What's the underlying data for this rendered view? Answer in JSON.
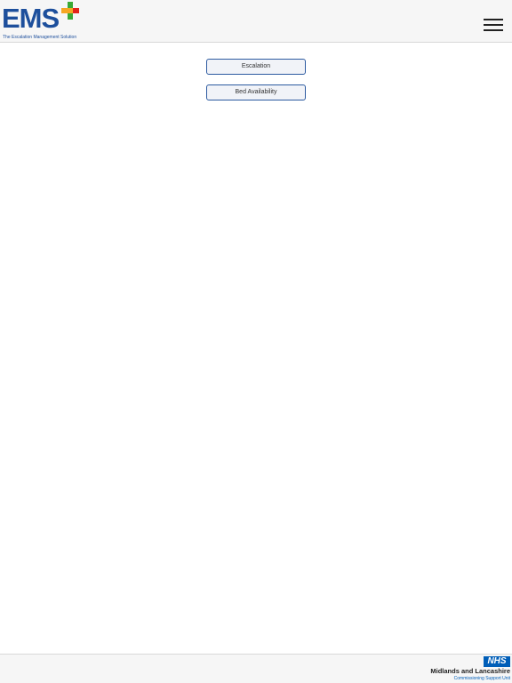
{
  "header": {
    "logo_text": "EMS",
    "logo_tagline": "The Escalation Management Solution",
    "menu_icon": "hamburger-menu-icon"
  },
  "main": {
    "buttons": [
      {
        "label": "Escalation"
      },
      {
        "label": "Bed Availability"
      }
    ]
  },
  "footer": {
    "nhs_logo_text": "NHS",
    "org_name": "Midlands and Lancashire",
    "org_subtitle": "Commissioning Support Unit"
  },
  "colors": {
    "brand_blue": "#1d4f9c",
    "cross_green": "#3aa935",
    "cross_orange": "#f5a623",
    "cross_red": "#e2231a",
    "nhs_blue": "#005eb8",
    "button_border": "#2c5aa0"
  }
}
